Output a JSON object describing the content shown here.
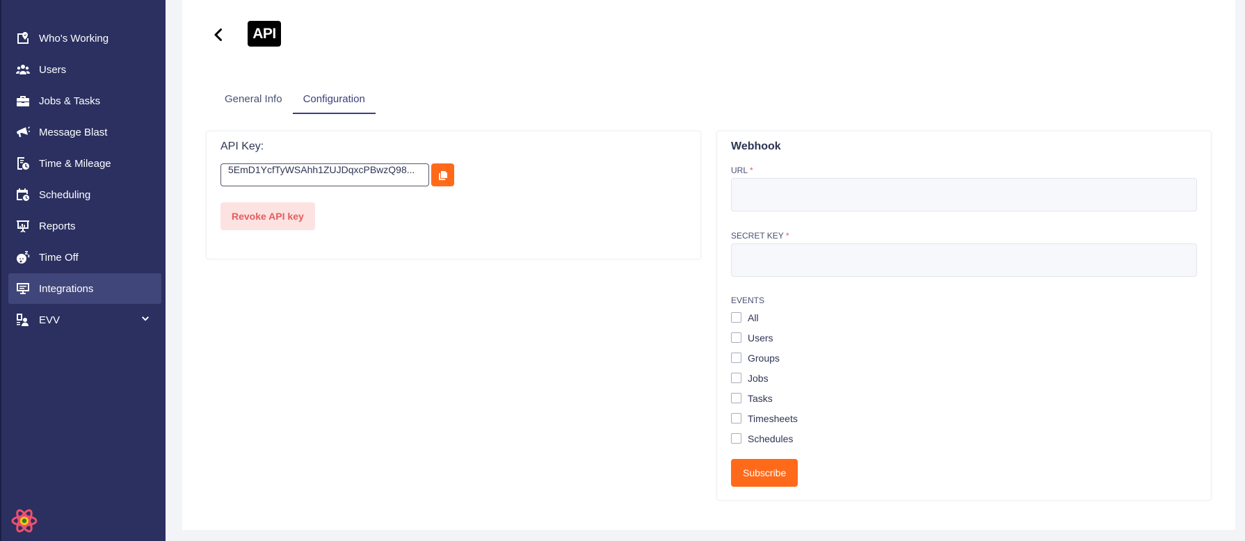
{
  "sidebar": {
    "items": [
      {
        "label": "Who's Working",
        "icon": "map-pin-icon"
      },
      {
        "label": "Users",
        "icon": "users-icon"
      },
      {
        "label": "Jobs & Tasks",
        "icon": "briefcase-icon"
      },
      {
        "label": "Message Blast",
        "icon": "megaphone-icon"
      },
      {
        "label": "Time & Mileage",
        "icon": "timesheet-icon"
      },
      {
        "label": "Scheduling",
        "icon": "calendar-clock-icon"
      },
      {
        "label": "Reports",
        "icon": "presentation-chart-icon"
      },
      {
        "label": "Time Off",
        "icon": "sleeping-face-icon"
      },
      {
        "label": "Integrations",
        "icon": "monitor-icon",
        "active": true
      },
      {
        "label": "EVV",
        "icon": "user-badge-icon",
        "expandable": true
      }
    ]
  },
  "header": {
    "logo_text": "API"
  },
  "tabs": [
    {
      "label": "General Info",
      "active": false
    },
    {
      "label": "Configuration",
      "active": true
    }
  ],
  "api_card": {
    "label": "API Key:",
    "api_key_value": "5EmD1YcfTyWSAhh1ZUJDqxcPBwzQ98...",
    "revoke_label": "Revoke API key"
  },
  "webhook": {
    "title": "Webhook",
    "url_label": "URL",
    "url_value": "",
    "secret_key_label": "SECRET KEY",
    "secret_key_value": "",
    "required_mark": "*",
    "events_label": "EVENTS",
    "events": [
      "All",
      "Users",
      "Groups",
      "Jobs",
      "Tasks",
      "Timesheets",
      "Schedules"
    ],
    "subscribe_label": "Subscribe"
  },
  "colors": {
    "sidebar_bg": "#2b3061",
    "sidebar_active": "#41467a",
    "accent": "#ff6a1a",
    "danger_soft": "#fde2e2",
    "danger_text": "#e35d5d"
  }
}
